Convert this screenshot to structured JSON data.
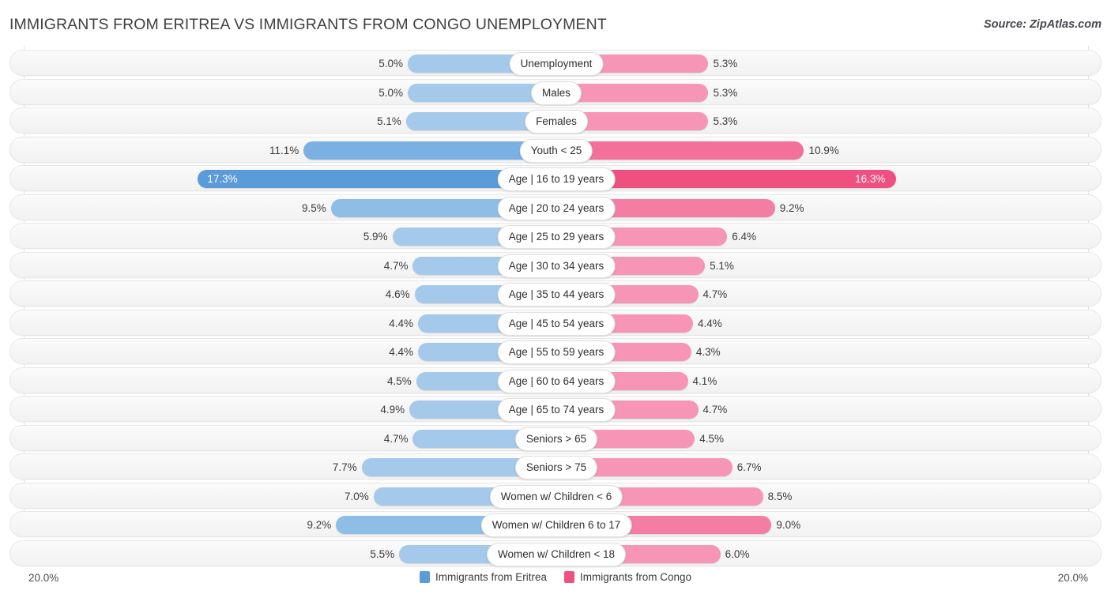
{
  "header": {
    "title": "IMMIGRANTS FROM ERITREA VS IMMIGRANTS FROM CONGO UNEMPLOYMENT",
    "source": "Source: ZipAtlas.com"
  },
  "axis": {
    "left_max_label": "20.0%",
    "right_max_label": "20.0%"
  },
  "legend": {
    "items": [
      {
        "label": "Immigrants from Eritrea",
        "color": "#5b9bd9"
      },
      {
        "label": "Immigrants from Congo",
        "color": "#f0507f"
      }
    ]
  },
  "colors": {
    "left_base": "#a4c9ea",
    "right_base": "#f695b5",
    "left_peak": "#5b9bd9",
    "right_peak": "#f0507f",
    "row_background": "#f6f6f6",
    "gridline": "#e3e3e3"
  },
  "chart_data": {
    "type": "bar",
    "title": "IMMIGRANTS FROM ERITREA VS IMMIGRANTS FROM CONGO UNEMPLOYMENT",
    "subtitle": "",
    "xlabel": "",
    "ylabel": "",
    "orientation": "horizontal-diverging",
    "xlim": [
      0,
      20
    ],
    "grid": true,
    "legend_position": "bottom-center",
    "categories": [
      "Unemployment",
      "Males",
      "Females",
      "Youth < 25",
      "Age | 16 to 19 years",
      "Age | 20 to 24 years",
      "Age | 25 to 29 years",
      "Age | 30 to 34 years",
      "Age | 35 to 44 years",
      "Age | 45 to 54 years",
      "Age | 55 to 59 years",
      "Age | 60 to 64 years",
      "Age | 65 to 74 years",
      "Seniors > 65",
      "Seniors > 75",
      "Women w/ Children < 6",
      "Women w/ Children 6 to 17",
      "Women w/ Children < 18"
    ],
    "series": [
      {
        "name": "Immigrants from Eritrea",
        "values": [
          5.0,
          5.0,
          5.1,
          11.1,
          17.3,
          9.5,
          5.9,
          4.7,
          4.6,
          4.4,
          4.4,
          4.5,
          4.9,
          4.7,
          7.7,
          7.0,
          9.2,
          5.5
        ],
        "labels": [
          "5.0%",
          "5.0%",
          "5.1%",
          "11.1%",
          "17.3%",
          "9.5%",
          "5.9%",
          "4.7%",
          "4.6%",
          "4.4%",
          "4.4%",
          "4.5%",
          "4.9%",
          "4.7%",
          "7.7%",
          "7.0%",
          "9.2%",
          "5.5%"
        ]
      },
      {
        "name": "Immigrants from Congo",
        "values": [
          5.3,
          5.3,
          5.3,
          10.9,
          16.3,
          9.2,
          6.4,
          5.1,
          4.7,
          4.4,
          4.3,
          4.1,
          4.7,
          4.5,
          6.7,
          8.5,
          9.0,
          6.0
        ],
        "labels": [
          "5.3%",
          "5.3%",
          "5.3%",
          "10.9%",
          "16.3%",
          "9.2%",
          "6.4%",
          "5.1%",
          "4.7%",
          "4.4%",
          "4.3%",
          "4.1%",
          "4.7%",
          "4.5%",
          "6.7%",
          "8.5%",
          "9.0%",
          "6.0%"
        ]
      }
    ]
  }
}
